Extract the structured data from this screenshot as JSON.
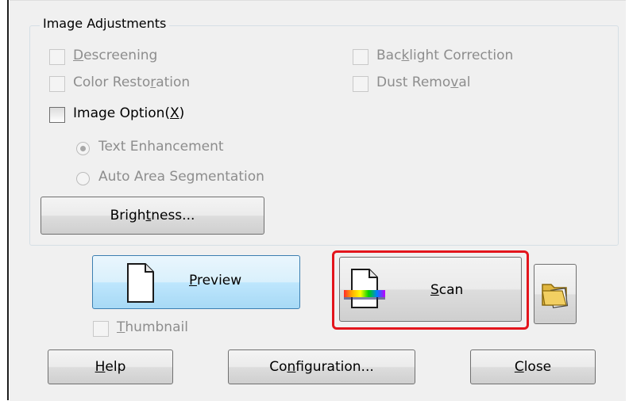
{
  "group": {
    "title": "Image Adjustments"
  },
  "checkboxes": {
    "descreening": {
      "pre": "",
      "ul": "D",
      "post": "escreening"
    },
    "color_restoration": {
      "pre": "Color Resto",
      "ul": "r",
      "post": "ation"
    },
    "backlight_correction": {
      "pre": "Bac",
      "ul": "k",
      "post": "light Correction"
    },
    "dust_removal": {
      "pre": "Dust Remo",
      "ul": "v",
      "post": "al"
    },
    "image_option": {
      "pre": "Image Option(",
      "ul": "X",
      "post": ")"
    },
    "thumbnail": {
      "pre": "",
      "ul": "T",
      "post": "humbnail"
    }
  },
  "radios": {
    "text_enhancement": "Text Enhancement",
    "auto_area_segmentation": "Auto Area Segmentation"
  },
  "buttons": {
    "brightness": {
      "pre": "Brigh",
      "ul": "t",
      "post": "ness..."
    },
    "preview": {
      "pre": "",
      "ul": "P",
      "post": "review"
    },
    "scan": {
      "pre": "",
      "ul": "S",
      "post": "can"
    },
    "help": {
      "pre": "",
      "ul": "H",
      "post": "elp"
    },
    "configuration": {
      "pre": "Co",
      "ul": "n",
      "post": "figuration..."
    },
    "close": {
      "pre": "",
      "ul": "C",
      "post": "lose"
    }
  },
  "icons": {
    "preview": "document-icon",
    "scan": "scan-document-icon",
    "folder": "folder-icon"
  },
  "colors": {
    "highlight": "#e3151c",
    "preview_border": "#3c7fb1"
  }
}
